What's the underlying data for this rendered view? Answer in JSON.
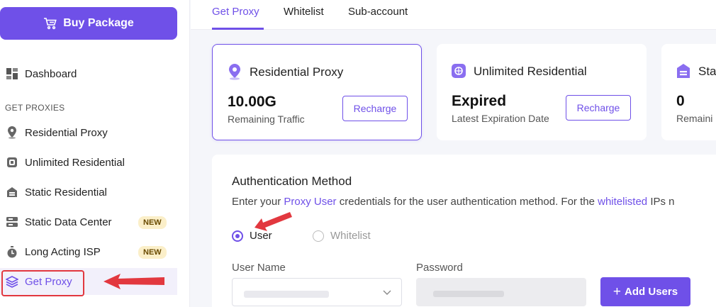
{
  "sidebar": {
    "buy_button": "Buy Package",
    "dashboard": "Dashboard",
    "section_title": "GET PROXIES",
    "items": [
      {
        "label": "Residential Proxy",
        "icon": "location-pin-icon"
      },
      {
        "label": "Unlimited Residential",
        "icon": "chip-icon"
      },
      {
        "label": "Static Residential",
        "icon": "house-icon"
      },
      {
        "label": "Static Data Center",
        "icon": "server-icon",
        "badge": "NEW"
      },
      {
        "label": "Long Acting ISP",
        "icon": "stopwatch-icon",
        "badge": "NEW"
      },
      {
        "label": "Get Proxy",
        "icon": "layers-icon",
        "active": true
      }
    ]
  },
  "tabs": [
    {
      "label": "Get Proxy",
      "active": true
    },
    {
      "label": "Whitelist"
    },
    {
      "label": "Sub-account"
    }
  ],
  "cards": [
    {
      "title": "Residential Proxy",
      "value": "10.00G",
      "sub": "Remaining Traffic",
      "button": "Recharge"
    },
    {
      "title": "Unlimited Residential",
      "value": "Expired",
      "sub": "Latest Expiration Date",
      "button": "Recharge"
    },
    {
      "title": "Sta",
      "value": "0",
      "sub": "Remaini"
    }
  ],
  "auth": {
    "title": "Authentication Method",
    "desc_prefix": "Enter your ",
    "desc_link1": "Proxy User",
    "desc_middle": " credentials for the user authentication method. For the ",
    "desc_link2": "whitelisted",
    "desc_suffix": " IPs n",
    "radio_user": "User",
    "radio_whitelist": "Whitelist",
    "username_label": "User Name",
    "password_label": "Password",
    "add_users_button": "Add Users"
  },
  "colors": {
    "accent": "#6f50e8",
    "annotation_red": "#e2383f",
    "badge_bg": "#fbefc9"
  }
}
